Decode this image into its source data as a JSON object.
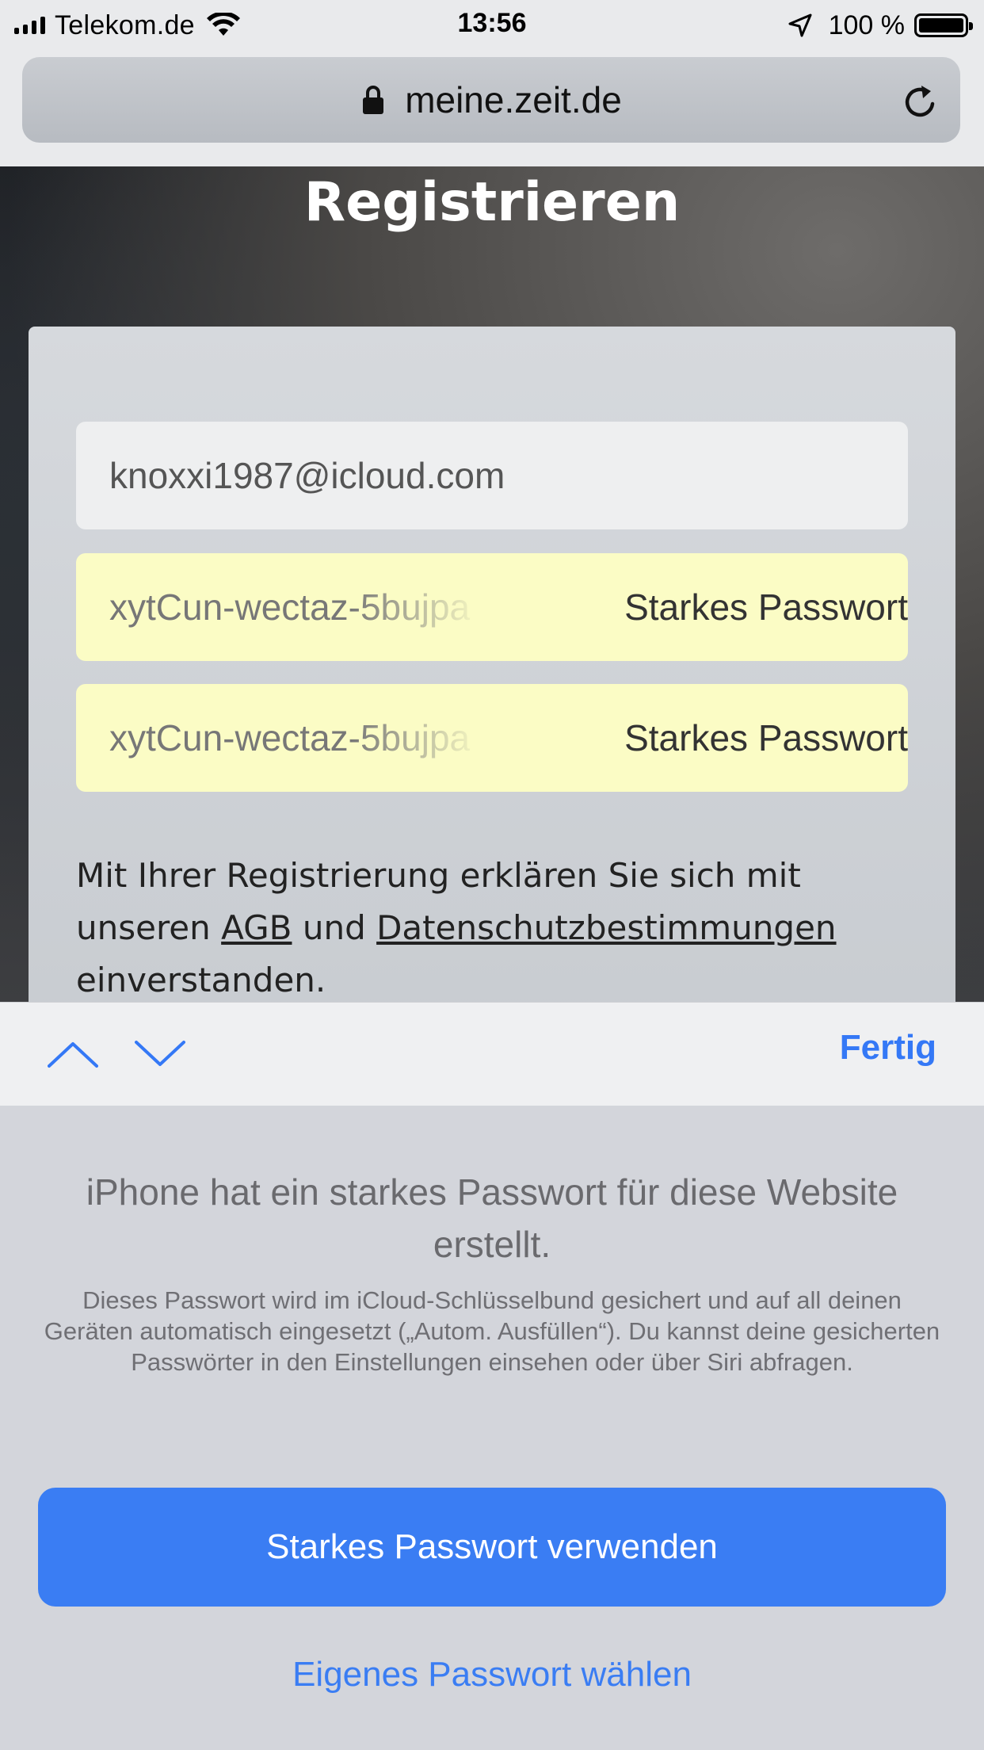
{
  "status_bar": {
    "carrier": "Telekom.de",
    "time": "13:56",
    "battery": "100 %"
  },
  "browser": {
    "url": "meine.zeit.de"
  },
  "page": {
    "title": "Registrieren",
    "email_value": "knoxxi1987@icloud.com",
    "password_value": "xytCun-wectaz-5bujpa",
    "password_confirm_value": "xytCun-wectaz-5bujpa",
    "strong_password_label": "Starkes Passwort",
    "terms": {
      "before": "Mit Ihrer Registrierung erklären Sie sich mit unseren ",
      "agb_link": "AGB",
      "middle": " und ",
      "privacy_link": "Datenschutzbestimmungen",
      "after": " einverstanden."
    }
  },
  "toolbar": {
    "done_label": "Fertig"
  },
  "sheet": {
    "heading": "iPhone hat ein starkes Passwort für diese Website erstellt.",
    "description": "Dieses Passwort wird im iCloud-Schlüsselbund gesichert und auf all deinen Geräten automatisch eingesetzt („Autom. Ausfüllen“). Du kannst deine gesicherten Passwörter in den Einstellungen einsehen oder über Siri abfragen.",
    "primary_button": "Starkes Passwort verwenden",
    "secondary_button": "Eigenes Passwort wählen"
  },
  "colors": {
    "accent": "#3a7df3",
    "autofill_yellow": "#fbfcc5"
  }
}
